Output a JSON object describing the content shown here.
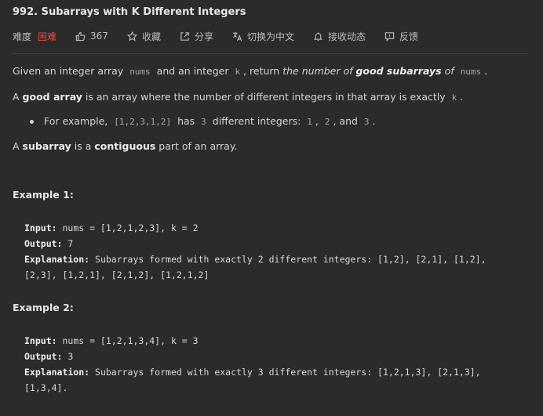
{
  "problem": {
    "title": "992. Subarrays with K Different Integers"
  },
  "meta": {
    "difficulty_label": "难度",
    "difficulty": "困难",
    "difficulty_color": "#ef4743",
    "likes": "367",
    "collect": "收藏",
    "share": "分享",
    "translate": "切换为中文",
    "notify": "接收动态",
    "feedback": "反馈"
  },
  "description": {
    "p1": {
      "a": "Given an integer array ",
      "code_nums": "nums",
      "b": " and an integer ",
      "code_k": "k",
      "c": ", return ",
      "i1": "the number of ",
      "b1": "good subarrays",
      "i2": " of ",
      "code_nums2": "nums",
      "d": "."
    },
    "p2": {
      "a": "A ",
      "b1": "good array",
      "b": " is an array where the number of different integers in that array is exactly ",
      "code_k": "k",
      "c": "."
    },
    "bullet": {
      "a": "For example, ",
      "code_arr": "[1,2,3,1,2]",
      "b": " has ",
      "code_3": "3",
      "c": " different integers: ",
      "code_1": "1",
      "d": ", ",
      "code_2": "2",
      "e": ", and ",
      "code_3b": "3",
      "f": "."
    },
    "p3": {
      "a": "A ",
      "b1": "subarray",
      "b": " is a ",
      "b2": "contiguous",
      "c": " part of an array."
    }
  },
  "examples": [
    {
      "title": "Example 1:",
      "input_label": "Input:",
      "input": " nums = [1,2,1,2,3], k = 2",
      "output_label": "Output:",
      "output": " 7",
      "explanation_label": "Explanation:",
      "explanation_1": " Subarrays formed with exactly 2 different integers: [1,2], [2,1], [1,2],",
      "explanation_2": "[2,3], [1,2,1], [2,1,2], [1,2,1,2]"
    },
    {
      "title": "Example 2:",
      "input_label": "Input:",
      "input": " nums = [1,2,1,3,4], k = 3",
      "output_label": "Output:",
      "output": " 3",
      "explanation_label": "Explanation:",
      "explanation_1": " Subarrays formed with exactly 3 different integers: [1,2,1,3], [2,1,3],",
      "explanation_2": "[1,3,4]."
    }
  ]
}
